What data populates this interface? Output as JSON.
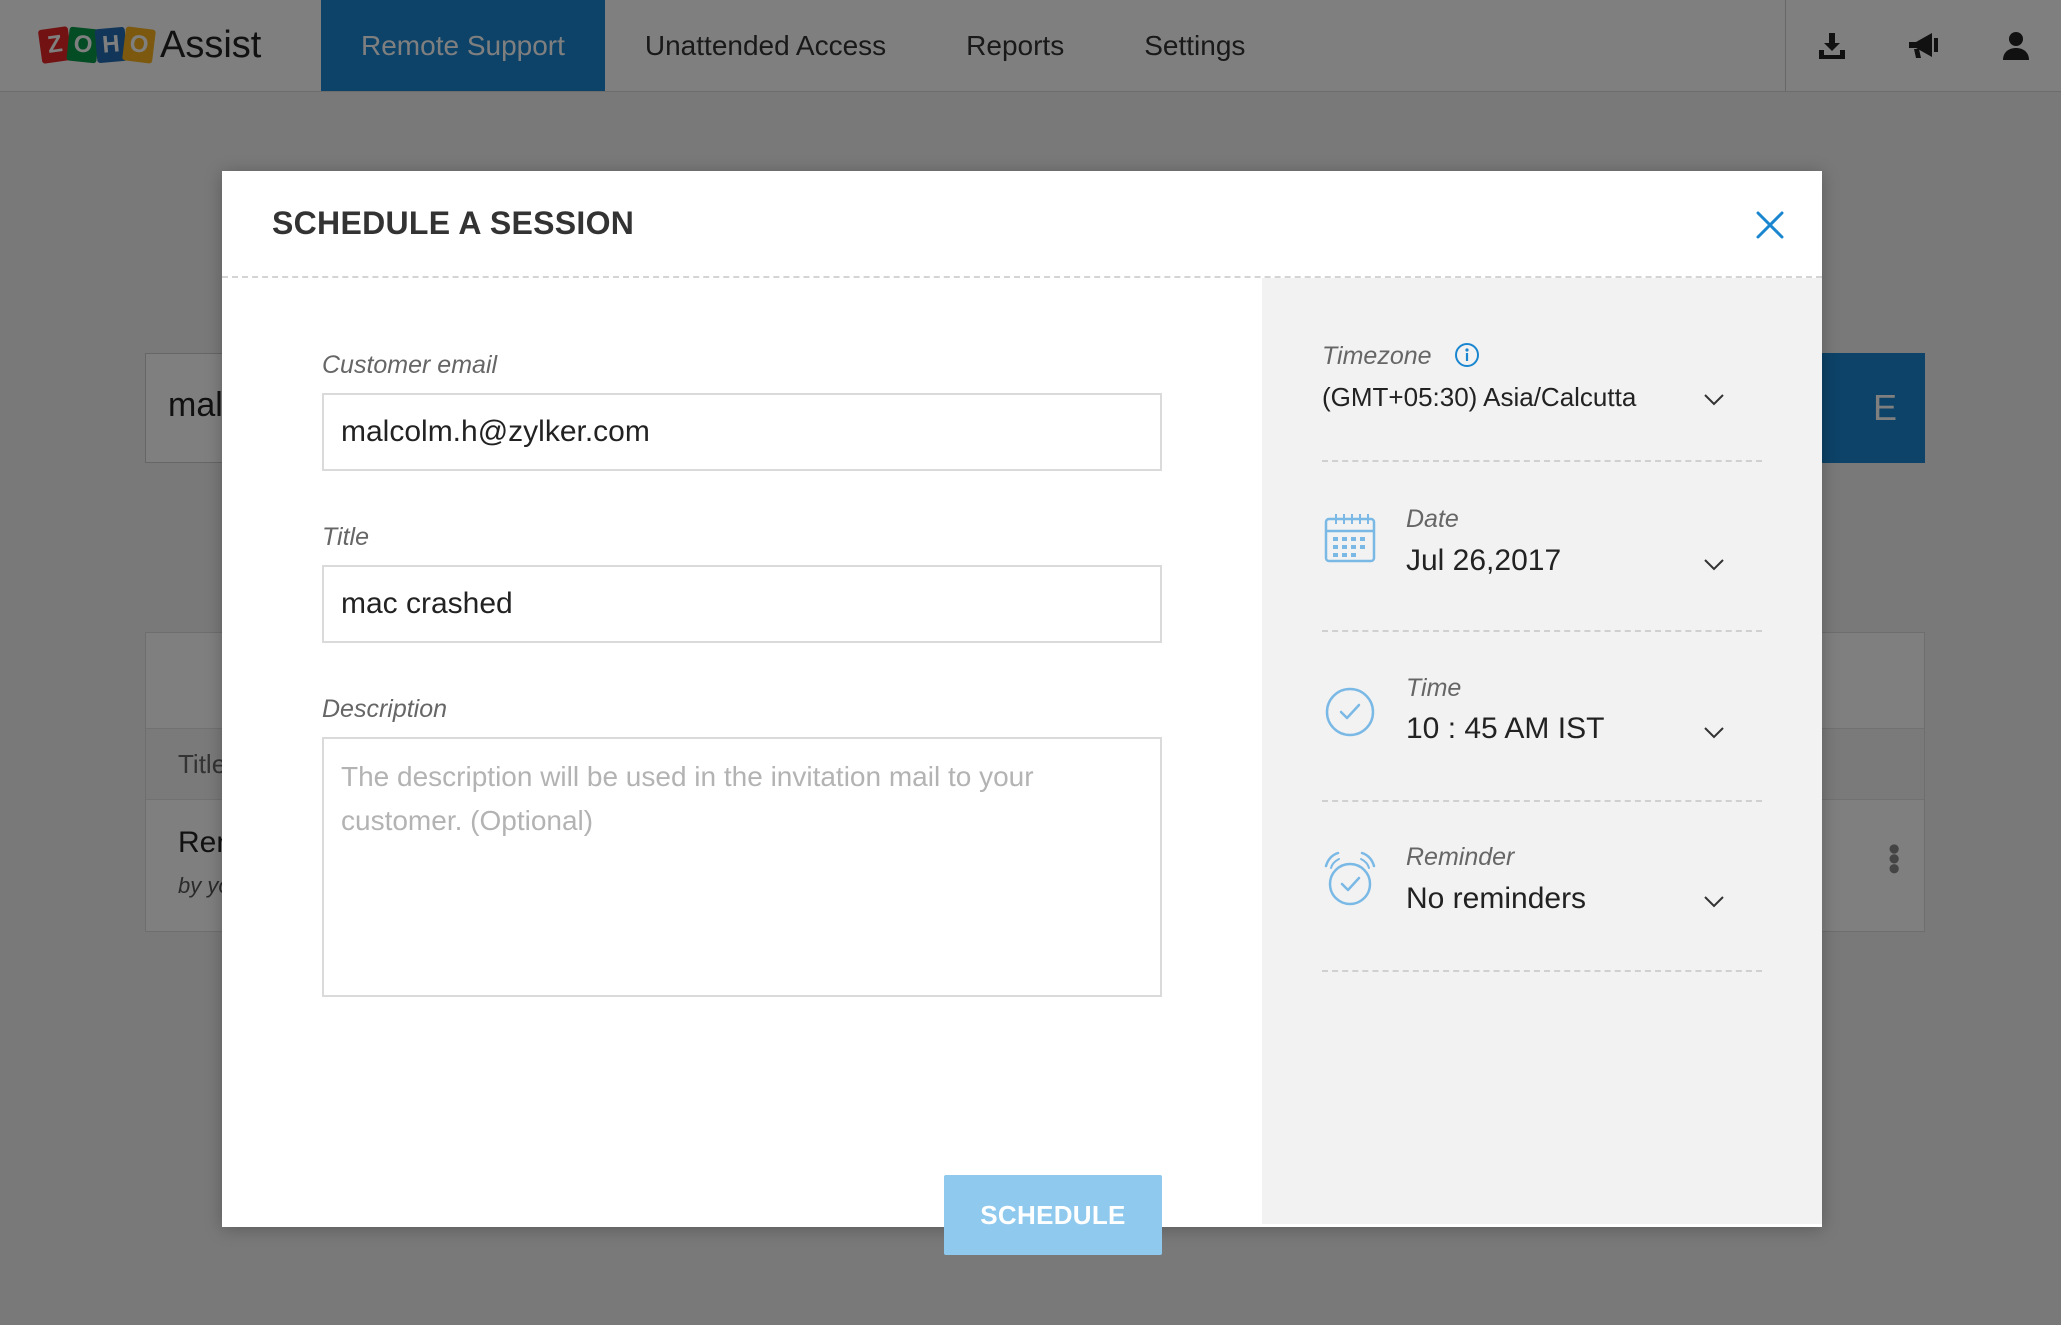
{
  "app": {
    "brand_letters": [
      "Z",
      "O",
      "H",
      "O"
    ],
    "brand_word": "Assist"
  },
  "nav": {
    "items": [
      {
        "label": "Remote Support",
        "active": true
      },
      {
        "label": "Unattended Access",
        "active": false
      },
      {
        "label": "Reports",
        "active": false
      },
      {
        "label": "Settings",
        "active": false
      }
    ],
    "icons": [
      "download-icon",
      "announcement-icon",
      "user-icon"
    ]
  },
  "background": {
    "input_value_partial": "mal",
    "cta_partial": "E",
    "table_header_partial": "Title",
    "row_title_partial": "Ren",
    "row_sub_partial": "by yo"
  },
  "modal": {
    "title": "SCHEDULE A SESSION",
    "close_icon": "close-icon",
    "fields": {
      "customer_email": {
        "label": "Customer email",
        "value": "malcolm.h@zylker.com"
      },
      "title": {
        "label": "Title",
        "value": "mac crashed"
      },
      "description": {
        "label": "Description",
        "value": "",
        "placeholder": "The description will be used in the invitation mail to your customer. (Optional)"
      }
    },
    "schedule_button": "SCHEDULE",
    "side": {
      "timezone": {
        "label": "Timezone",
        "value": "(GMT+05:30) Asia/Calcutta",
        "icon": "info-icon"
      },
      "date": {
        "label": "Date",
        "value": "Jul 26,2017",
        "icon": "calendar-icon"
      },
      "time": {
        "label": "Time",
        "value": "10 : 45 AM IST",
        "icon": "clock-icon"
      },
      "reminder": {
        "label": "Reminder",
        "value": "No reminders",
        "icon": "alarm-icon"
      }
    }
  },
  "colors": {
    "accent": "#1a86d0",
    "button_disabled": "#8fc9ee",
    "icon_blue": "#7ab9e6",
    "overlay": "rgba(0,0,0,0.5)"
  }
}
